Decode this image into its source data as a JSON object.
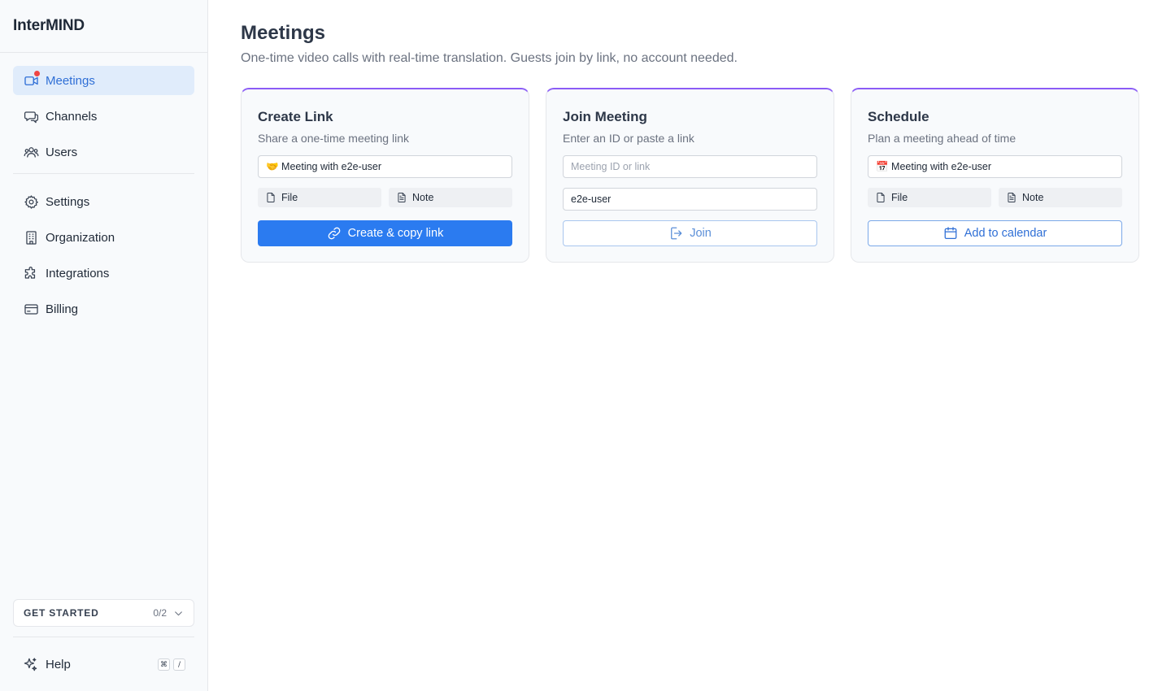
{
  "app": {
    "brand": "InterMIND"
  },
  "sidebar": {
    "items": [
      {
        "label": "Meetings",
        "icon": "video-icon"
      },
      {
        "label": "Channels",
        "icon": "chat-icon"
      },
      {
        "label": "Users",
        "icon": "users-icon"
      },
      {
        "label": "Settings",
        "icon": "gear-icon"
      },
      {
        "label": "Organization",
        "icon": "building-icon"
      },
      {
        "label": "Integrations",
        "icon": "puzzle-icon"
      },
      {
        "label": "Billing",
        "icon": "credit-card-icon"
      }
    ],
    "get_started": {
      "label": "GET STARTED",
      "count": "0/2"
    },
    "help": {
      "label": "Help",
      "shortcut_key1": "⌘",
      "shortcut_key2": "/"
    }
  },
  "main": {
    "title": "Meetings",
    "subtitle": "One-time video calls with real-time translation. Guests join by link, no account needed."
  },
  "cards": {
    "create": {
      "title": "Create Link",
      "desc": "Share a one-time meeting link",
      "input_value": "🤝 Meeting with e2e-user",
      "file_label": "File",
      "note_label": "Note",
      "button_label": "Create & copy link"
    },
    "join": {
      "title": "Join Meeting",
      "desc": "Enter an ID or paste a link",
      "id_placeholder": "Meeting ID or link",
      "name_value": "e2e-user",
      "button_label": "Join"
    },
    "schedule": {
      "title": "Schedule",
      "desc": "Plan a meeting ahead of time",
      "input_value": "📅 Meeting with e2e-user",
      "file_label": "File",
      "note_label": "Note",
      "button_label": "Add to calendar"
    }
  },
  "colors": {
    "accent": "#2b7bf0",
    "active_bg": "#e0ecfb",
    "card_border_top": "#8b5cf6",
    "notification_dot": "#ef4444"
  }
}
